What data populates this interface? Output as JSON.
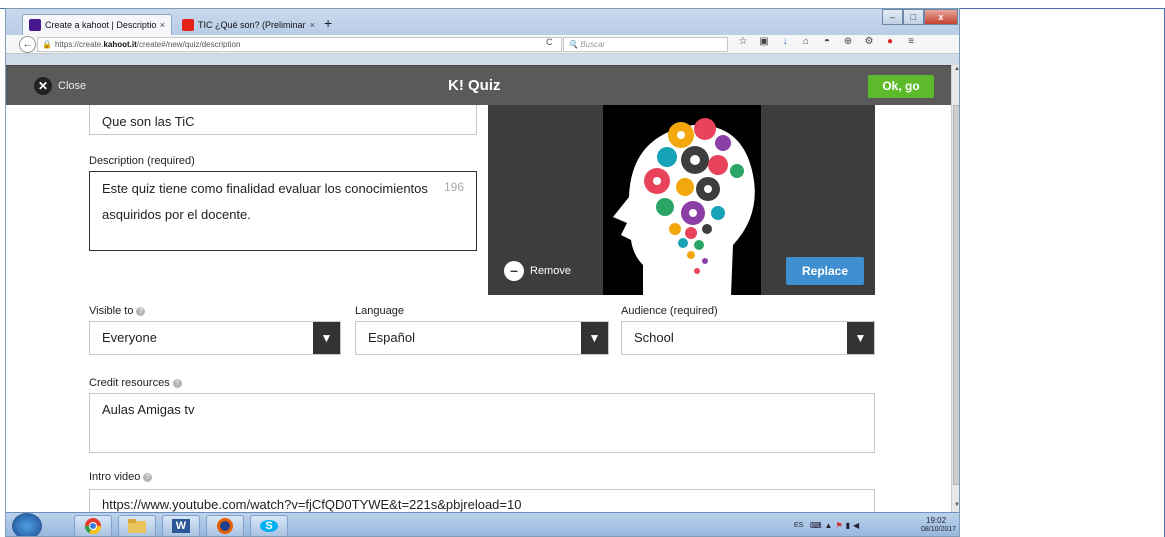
{
  "browser": {
    "tabs": [
      {
        "label": "Create a kahoot | Description",
        "close": "×"
      },
      {
        "label": "TIC ¿Qué son? (Preliminar) -",
        "close": "×"
      }
    ],
    "new_tab": "+",
    "window_controls": {
      "minimize": "–",
      "maximize": "□",
      "close": "x"
    },
    "back": "←",
    "url_prefix": "https://create.",
    "url_domain": "kahoot.it",
    "url_path": "/create#/new/quiz/description",
    "reload": "C",
    "search_placeholder": "Buscar",
    "toolbar_icons": [
      "☆",
      "▣",
      "↓",
      "⌂",
      "◓",
      "⊕",
      "⚙",
      "●",
      "≡"
    ]
  },
  "app_header": {
    "close_label": "Close",
    "title": "K! Quiz",
    "ok_label": "Ok, go"
  },
  "form": {
    "title_value": "Que son las TiC",
    "description_label": "Description (required)",
    "description_value": "Este quiz tiene como finalidad evaluar los conocimientos asquiridos por el docente.",
    "description_count": "196",
    "remove_label": "Remove",
    "replace_label": "Replace",
    "visible_label": "Visible to",
    "visible_value": "Everyone",
    "language_label": "Language",
    "language_value": "Español",
    "audience_label": "Audience (required)",
    "audience_value": "School",
    "credit_label": "Credit resources",
    "credit_value": "Aulas Amigas tv",
    "intro_label": "Intro video",
    "intro_value": "https://www.youtube.com/watch?v=fjCfQD0TYWE&t=221s&pbjreload=10"
  },
  "taskbar": {
    "apps": [
      "chrome-icon",
      "folder-icon",
      "word-icon",
      "firefox-icon",
      "skype-icon"
    ],
    "word_glyph": "W",
    "skype_glyph": "S",
    "tray_lang": "ES",
    "time": "19:02",
    "date": "08/10/2017"
  },
  "colors": {
    "kahoot_purple": "#46178f",
    "ok_green": "#5cba2b",
    "replace_blue": "#3e8ed0",
    "header_gray": "#5a5a5a"
  }
}
